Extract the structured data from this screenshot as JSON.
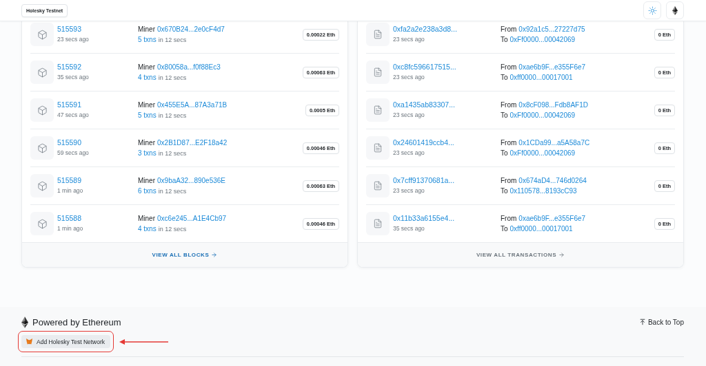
{
  "header": {
    "network_badge": "Holesky Testnet"
  },
  "blocks": {
    "rows": [
      {
        "number": "515593",
        "age": "23 secs ago",
        "miner_label": "Miner",
        "miner": "0x670B24...2e0cF4d7",
        "txns": "5 txns",
        "duration": "in 12 secs",
        "reward": "0.00022 Eth"
      },
      {
        "number": "515592",
        "age": "35 secs ago",
        "miner_label": "Miner",
        "miner": "0x80058a...f0f88Ec3",
        "txns": "4 txns",
        "duration": "in 12 secs",
        "reward": "0.00063 Eth"
      },
      {
        "number": "515591",
        "age": "47 secs ago",
        "miner_label": "Miner",
        "miner": "0x455E5A...87A3a71B",
        "txns": "5 txns",
        "duration": "in 12 secs",
        "reward": "0.0005 Eth"
      },
      {
        "number": "515590",
        "age": "59 secs ago",
        "miner_label": "Miner",
        "miner": "0x2B1D87...E2F18a42",
        "txns": "3 txns",
        "duration": "in 12 secs",
        "reward": "0.00046 Eth"
      },
      {
        "number": "515589",
        "age": "1 min ago",
        "miner_label": "Miner",
        "miner": "0x9baA32...890e536E",
        "txns": "6 txns",
        "duration": "in 12 secs",
        "reward": "0.00063 Eth"
      },
      {
        "number": "515588",
        "age": "1 min ago",
        "miner_label": "Miner",
        "miner": "0xc6e245...A1E4Cb97",
        "txns": "4 txns",
        "duration": "in 12 secs",
        "reward": "0.00046 Eth"
      }
    ],
    "view_all": {
      "label": "VIEW ALL BLOCKS",
      "active": true
    }
  },
  "transactions": {
    "rows": [
      {
        "hash": "0xfa2a2e238a3d8...",
        "age": "23 secs ago",
        "from_label": "From",
        "from": "0x92a1c5...27227d75",
        "to_label": "To",
        "to": "0xFf0000...00042069",
        "value": "0 Eth"
      },
      {
        "hash": "0xc8fc596617515...",
        "age": "23 secs ago",
        "from_label": "From",
        "from": "0xae6b9F...e355F6e7",
        "to_label": "To",
        "to": "0xff0000...00017001",
        "value": "0 Eth"
      },
      {
        "hash": "0xa1435ab83307...",
        "age": "23 secs ago",
        "from_label": "From",
        "from": "0x8cF098...Fdb8AF1D",
        "to_label": "To",
        "to": "0xFf0000...00042069",
        "value": "0 Eth"
      },
      {
        "hash": "0x24601419ccb4...",
        "age": "23 secs ago",
        "from_label": "From",
        "from": "0x1CDa99...a5A58a7C",
        "to_label": "To",
        "to": "0xFf0000...00042069",
        "value": "0 Eth"
      },
      {
        "hash": "0x7cff91370681a...",
        "age": "23 secs ago",
        "from_label": "From",
        "from": "0x674aD4...746d0264",
        "to_label": "To",
        "to": "0x110578...8193cC93",
        "value": "0 Eth"
      },
      {
        "hash": "0x11b33a6155e4...",
        "age": "35 secs ago",
        "from_label": "From",
        "from": "0xae6b9F...e355F6e7",
        "to_label": "To",
        "to": "0xff0000...00017001",
        "value": "0 Eth"
      }
    ],
    "view_all": {
      "label": "VIEW ALL TRANSACTIONS",
      "active": false
    }
  },
  "footer": {
    "powered_by": "Powered by Ethereum",
    "add_network": {
      "label": "Add Holesky Test Network",
      "highlighted": true
    },
    "back_to_top": "Back to Top"
  }
}
